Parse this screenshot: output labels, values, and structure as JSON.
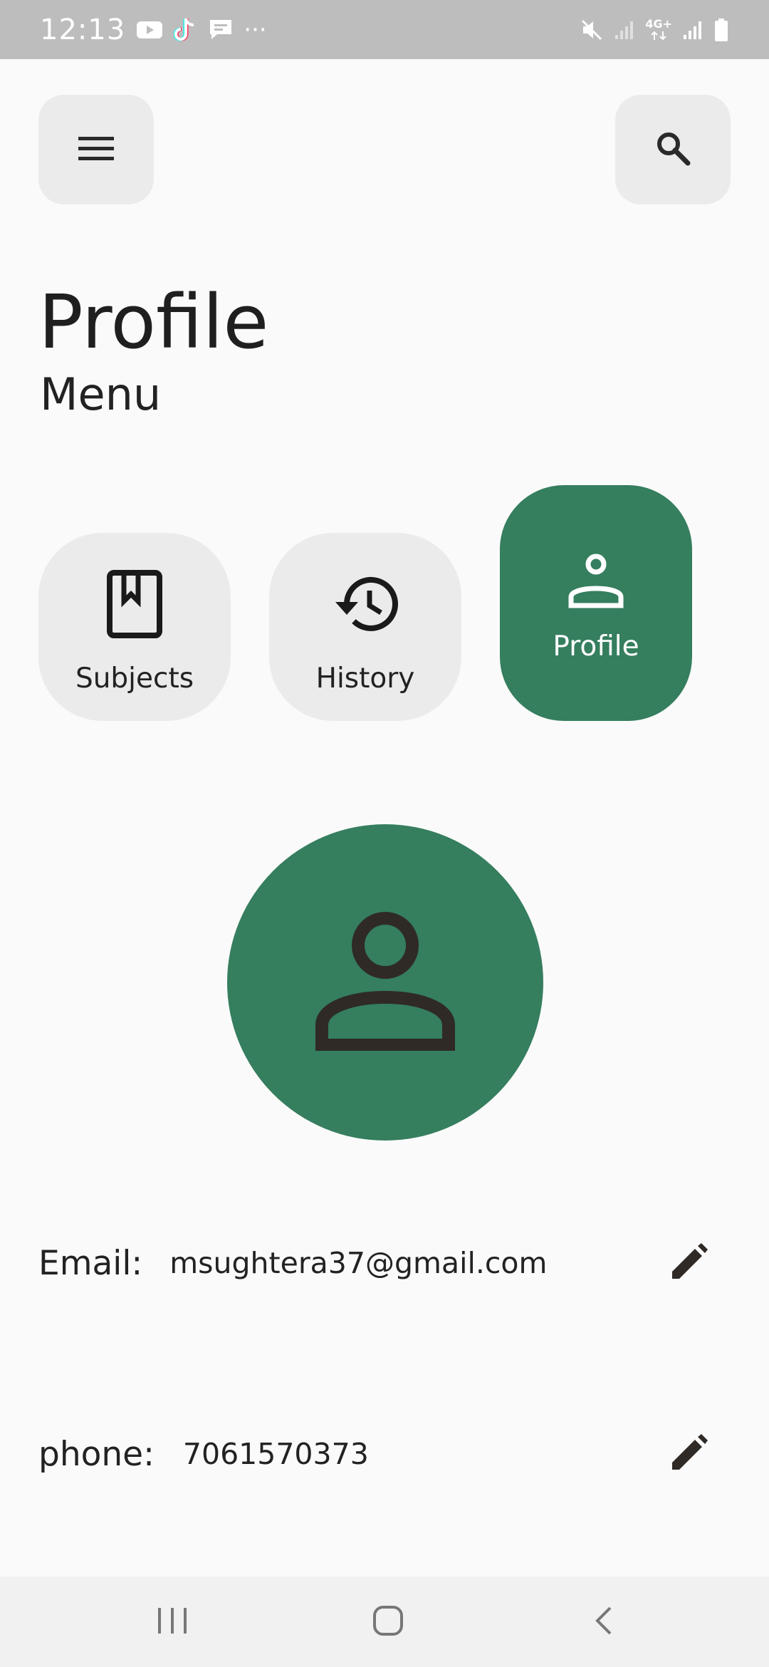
{
  "status_bar": {
    "time": "12:13",
    "left_icons": [
      "youtube-icon",
      "tiktok-icon",
      "message-icon",
      "more-icon"
    ],
    "more_text": "···",
    "network_label": "4G+",
    "right_icons": [
      "mute-icon",
      "signal-icon",
      "network-icon",
      "signal-icon",
      "battery-icon"
    ]
  },
  "header": {
    "menu_icon": "hamburger-menu-icon",
    "search_icon": "search-icon"
  },
  "page": {
    "title": "Profile",
    "subtitle": "Menu"
  },
  "tabs": [
    {
      "label": "Subjects",
      "icon": "book-icon",
      "active": false
    },
    {
      "label": "History",
      "icon": "history-icon",
      "active": false
    },
    {
      "label": "Profile",
      "icon": "person-icon",
      "active": true
    }
  ],
  "profile": {
    "avatar_icon": "person-icon",
    "email_label": "Email:",
    "email_value": "msughtera37@gmail.com",
    "phone_label": "phone:",
    "phone_value": "7061570373",
    "edit_icon": "pencil-icon"
  },
  "nav_bar": {
    "items": [
      "recents-icon",
      "home-icon",
      "back-icon"
    ]
  },
  "colors": {
    "accent": "#357e5e",
    "tile_bg": "#ebebeb",
    "background": "#fafafa",
    "status_bar": "#bdbdbd",
    "nav_bar": "#f1f1f1"
  }
}
